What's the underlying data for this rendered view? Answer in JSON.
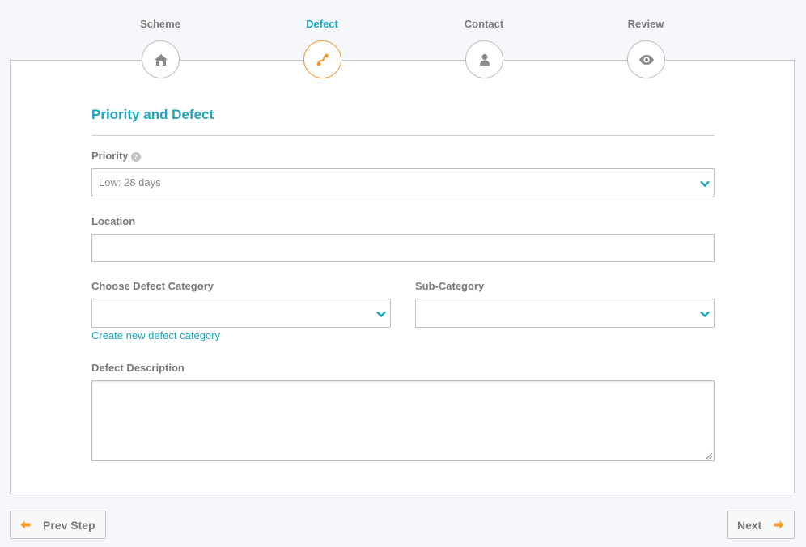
{
  "stepper": {
    "steps": [
      {
        "label": "Scheme",
        "icon": "home-icon"
      },
      {
        "label": "Defect",
        "icon": "route-icon",
        "active": true
      },
      {
        "label": "Contact",
        "icon": "user-icon"
      },
      {
        "label": "Review",
        "icon": "eye-icon"
      }
    ]
  },
  "form": {
    "section_title": "Priority and Defect",
    "priority": {
      "label": "Priority",
      "help_icon": "question-circle-icon",
      "selected": "Low: 28 days"
    },
    "location": {
      "label": "Location",
      "value": ""
    },
    "category": {
      "label": "Choose Defect Category",
      "selected": "",
      "create_link": "Create new defect category"
    },
    "subcategory": {
      "label": "Sub-Category",
      "selected": ""
    },
    "description": {
      "label": "Defect Description",
      "value": ""
    }
  },
  "footer": {
    "prev_label": "Prev Step",
    "next_label": "Next"
  },
  "colors": {
    "accent": "#1aa6c1",
    "active_step": "#f39a2b",
    "background": "#f6f7fa"
  }
}
